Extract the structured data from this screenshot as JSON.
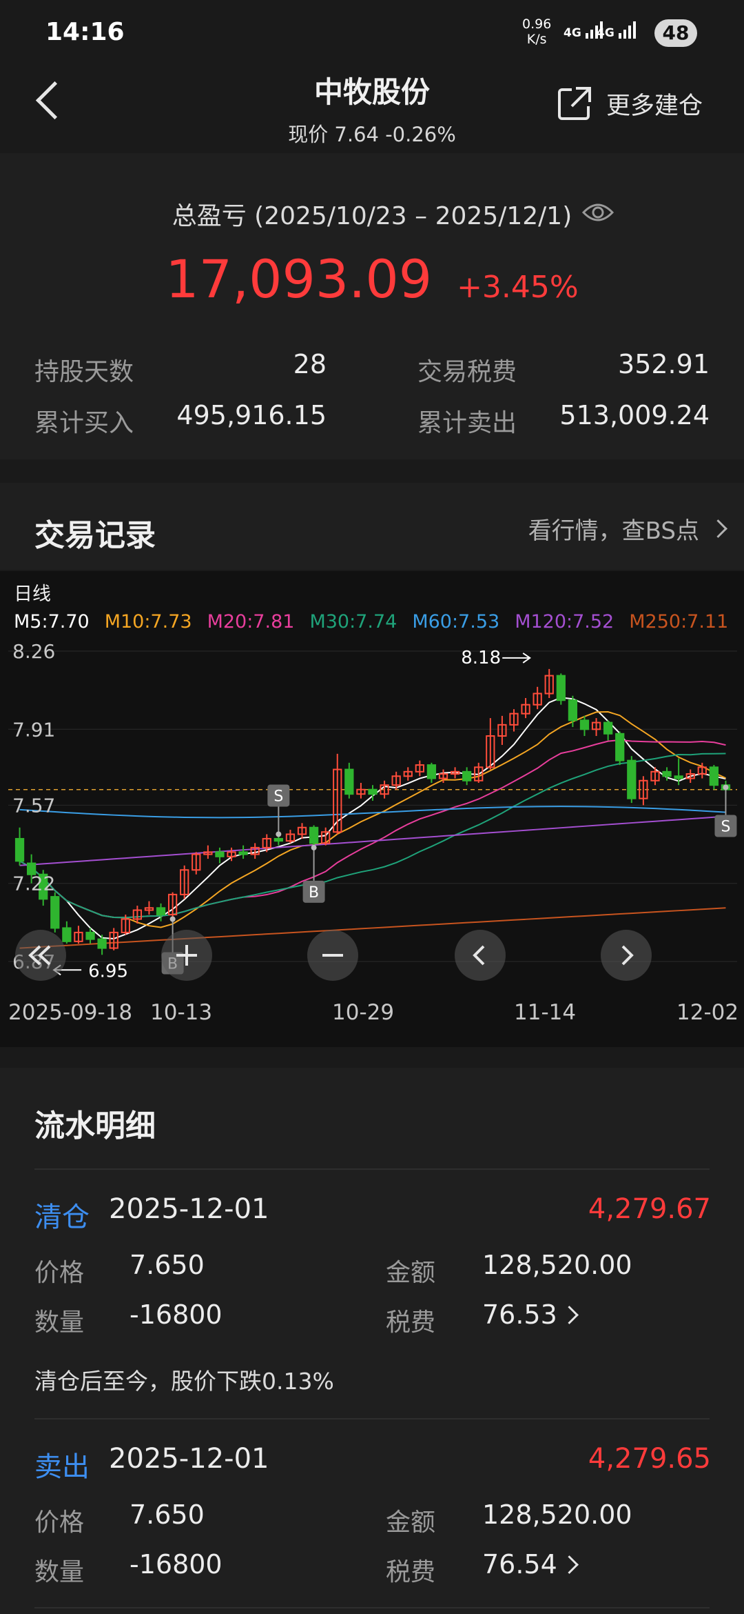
{
  "status": {
    "time": "14:16",
    "speed_value": "0.96",
    "speed_unit": "K/s",
    "net1": "4G",
    "net2": "4G",
    "battery": "48"
  },
  "nav": {
    "title": "中牧股份",
    "subtitle": "现价 7.64 -0.26%",
    "more_label": "更多建仓"
  },
  "summary": {
    "title": "总盈亏 (2025/10/23 – 2025/12/1)",
    "value": "17,093.09",
    "pct": "+3.45%",
    "hold_days_label": "持股天数",
    "hold_days": "28",
    "tax_label": "交易税费",
    "tax": "352.91",
    "buy_label": "累计买入",
    "buy": "495,916.15",
    "sell_label": "累计卖出",
    "sell": "513,009.24"
  },
  "trade": {
    "title": "交易记录",
    "link": "看行情，查BS点"
  },
  "chart": {
    "period": "日线",
    "ma": [
      {
        "label": "M5:7.70",
        "color": "#ffffff"
      },
      {
        "label": "M10:7.73",
        "color": "#f5a623"
      },
      {
        "label": "M20:7.81",
        "color": "#e83e9c"
      },
      {
        "label": "M30:7.74",
        "color": "#1fa37a"
      },
      {
        "label": "M60:7.53",
        "color": "#3a9ee6"
      },
      {
        "label": "M120:7.52",
        "color": "#a44fd1"
      },
      {
        "label": "M250:7.11",
        "color": "#c8541f"
      }
    ],
    "y_ticks": [
      "8.26",
      "7.91",
      "7.57",
      "7.22",
      "6.87"
    ],
    "high_label": "8.18",
    "low_label": "6.95",
    "x_dates": [
      "2025-09-18",
      "10-13",
      "10-29",
      "11-14",
      "12-02"
    ],
    "bs_marks": [
      "S",
      "B",
      "B",
      "S"
    ]
  },
  "chart_data": {
    "type": "candlestick",
    "up_color": "#ff4d3b",
    "down_color": "#2fb52f",
    "ylim": [
      6.87,
      8.26
    ],
    "x_range": [
      "2025-09-18",
      "2025-12-02"
    ],
    "candles": [
      [
        7.42,
        7.32,
        7.47,
        7.3
      ],
      [
        7.31,
        7.26,
        7.35,
        7.22
      ],
      [
        7.26,
        7.15,
        7.28,
        7.12
      ],
      [
        7.16,
        7.02,
        7.18,
        7.0
      ],
      [
        7.02,
        6.96,
        7.05,
        6.95
      ],
      [
        6.96,
        7.0,
        7.03,
        6.95
      ],
      [
        7.0,
        6.97,
        7.02,
        6.95
      ],
      [
        6.97,
        6.93,
        6.99,
        6.9
      ],
      [
        6.93,
        7.0,
        7.02,
        6.92
      ],
      [
        7.0,
        7.06,
        7.08,
        6.99
      ],
      [
        7.06,
        7.1,
        7.12,
        7.04
      ],
      [
        7.1,
        7.11,
        7.14,
        7.08
      ],
      [
        7.11,
        7.08,
        7.13,
        7.05
      ],
      [
        7.08,
        7.17,
        7.18,
        7.06
      ],
      [
        7.17,
        7.28,
        7.3,
        7.15
      ],
      [
        7.28,
        7.35,
        7.36,
        7.26
      ],
      [
        7.35,
        7.36,
        7.39,
        7.33
      ],
      [
        7.36,
        7.34,
        7.38,
        7.31
      ],
      [
        7.34,
        7.36,
        7.38,
        7.32
      ],
      [
        7.36,
        7.35,
        7.39,
        7.33
      ],
      [
        7.35,
        7.38,
        7.4,
        7.33
      ],
      [
        7.38,
        7.42,
        7.44,
        7.36
      ],
      [
        7.42,
        7.41,
        7.44,
        7.39
      ],
      [
        7.41,
        7.44,
        7.46,
        7.4
      ],
      [
        7.44,
        7.47,
        7.49,
        7.42
      ],
      [
        7.47,
        7.4,
        7.48,
        7.38
      ],
      [
        7.4,
        7.45,
        7.47,
        7.39
      ],
      [
        7.45,
        7.73,
        7.8,
        7.44
      ],
      [
        7.73,
        7.62,
        7.76,
        7.6
      ],
      [
        7.62,
        7.64,
        7.67,
        7.6
      ],
      [
        7.64,
        7.62,
        7.66,
        7.59
      ],
      [
        7.62,
        7.66,
        7.68,
        7.6
      ],
      [
        7.66,
        7.7,
        7.72,
        7.64
      ],
      [
        7.7,
        7.72,
        7.74,
        7.68
      ],
      [
        7.72,
        7.75,
        7.77,
        7.7
      ],
      [
        7.75,
        7.69,
        7.76,
        7.67
      ],
      [
        7.69,
        7.71,
        7.73,
        7.67
      ],
      [
        7.71,
        7.72,
        7.74,
        7.69
      ],
      [
        7.72,
        7.68,
        7.74,
        7.66
      ],
      [
        7.68,
        7.74,
        7.76,
        7.67
      ],
      [
        7.74,
        7.88,
        7.96,
        7.73
      ],
      [
        7.88,
        7.93,
        7.97,
        7.84
      ],
      [
        7.93,
        7.98,
        8.0,
        7.9
      ],
      [
        7.98,
        8.02,
        8.05,
        7.96
      ],
      [
        8.02,
        8.07,
        8.1,
        8.0
      ],
      [
        8.07,
        8.15,
        8.18,
        8.05
      ],
      [
        8.15,
        8.04,
        8.16,
        8.02
      ],
      [
        8.04,
        7.95,
        8.06,
        7.92
      ],
      [
        7.95,
        7.91,
        7.97,
        7.88
      ],
      [
        7.91,
        7.94,
        7.96,
        7.88
      ],
      [
        7.94,
        7.89,
        7.95,
        7.86
      ],
      [
        7.89,
        7.77,
        7.9,
        7.75
      ],
      [
        7.77,
        7.6,
        7.79,
        7.58
      ],
      [
        7.6,
        7.68,
        7.7,
        7.57
      ],
      [
        7.68,
        7.72,
        7.74,
        7.66
      ],
      [
        7.72,
        7.7,
        7.74,
        7.68
      ],
      [
        7.7,
        7.69,
        7.78,
        7.66
      ],
      [
        7.69,
        7.71,
        7.73,
        7.67
      ],
      [
        7.71,
        7.74,
        7.76,
        7.69
      ],
      [
        7.74,
        7.66,
        7.75,
        7.64
      ],
      [
        7.66,
        7.64,
        7.68,
        7.6
      ]
    ],
    "buy_sell": [
      {
        "type": "S",
        "date_index": 22,
        "price": 7.44
      },
      {
        "type": "B",
        "date_index": 25,
        "price": 7.38
      },
      {
        "type": "B",
        "date_index": 13,
        "price": 7.06
      },
      {
        "type": "S",
        "date_index": 60,
        "price": 7.65
      }
    ]
  },
  "flow": {
    "title": "流水明细",
    "items": [
      {
        "tag": "清仓",
        "date": "2025-12-01",
        "amount": "4,279.67",
        "price_label": "价格",
        "price": "7.650",
        "money_label": "金额",
        "money": "128,520.00",
        "qty_label": "数量",
        "qty": "-16800",
        "fee_label": "税费",
        "fee": "76.53",
        "note": "清仓后至今，股价下跌0.13%"
      },
      {
        "tag": "卖出",
        "date": "2025-12-01",
        "amount": "4,279.65",
        "price_label": "价格",
        "price": "7.650",
        "money_label": "金额",
        "money": "128,520.00",
        "qty_label": "数量",
        "qty": "-16800",
        "fee_label": "税费",
        "fee": "76.54"
      }
    ]
  }
}
